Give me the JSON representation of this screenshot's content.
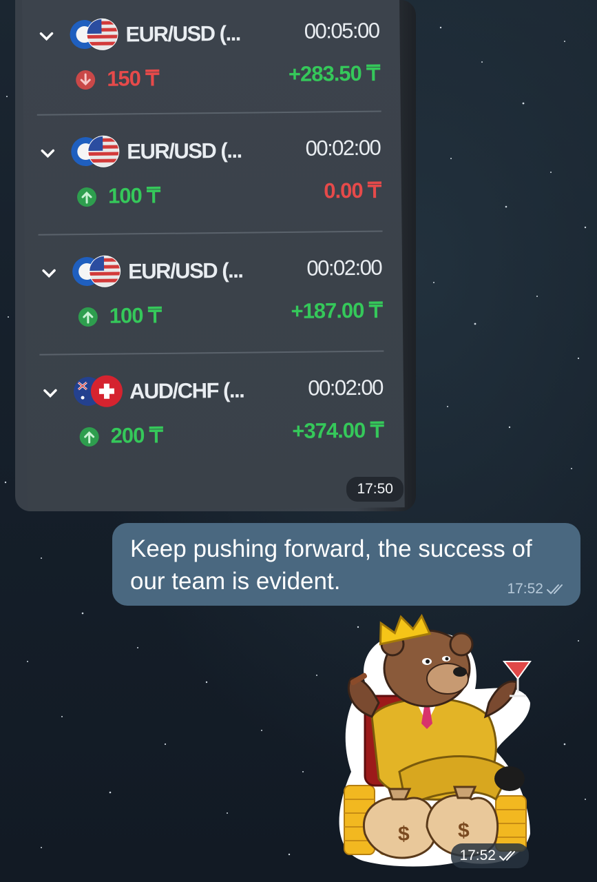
{
  "photo_message": {
    "trades": [
      {
        "pair": "EUR/USD (...",
        "duration": "00:05:00",
        "amount": "150 ₸",
        "result": "+283.50 ₸",
        "direction": "down",
        "amount_color": "#e64a4a",
        "result_color": "#35c85a",
        "base_flag": "EUR",
        "quote_flag": "USD"
      },
      {
        "pair": "EUR/USD (...",
        "duration": "00:02:00",
        "amount": "100 ₸",
        "result": "0.00 ₸",
        "direction": "up",
        "amount_color": "#35c85a",
        "result_color": "#e64a4a",
        "base_flag": "EUR",
        "quote_flag": "USD"
      },
      {
        "pair": "EUR/USD (...",
        "duration": "00:02:00",
        "amount": "100 ₸",
        "result": "+187.00 ₸",
        "direction": "up",
        "amount_color": "#35c85a",
        "result_color": "#35c85a",
        "base_flag": "EUR",
        "quote_flag": "USD"
      },
      {
        "pair": "AUD/CHF (...",
        "duration": "00:02:00",
        "amount": "200 ₸",
        "result": "+374.00 ₸",
        "direction": "up",
        "amount_color": "#35c85a",
        "result_color": "#35c85a",
        "base_flag": "AUD",
        "quote_flag": "CHF"
      }
    ],
    "time": "17:50"
  },
  "text_message": {
    "text": "Keep pushing forward, the success of our team is evident.",
    "time": "17:52",
    "status_icon": "double-check-icon"
  },
  "sticker_message": {
    "sticker": "bear-king-sticker",
    "time": "17:52",
    "status_icon": "double-check-icon"
  },
  "colors": {
    "outgoing_bubble": "#4a6880",
    "profit_green": "#35c85a",
    "loss_red": "#e64a4a"
  }
}
